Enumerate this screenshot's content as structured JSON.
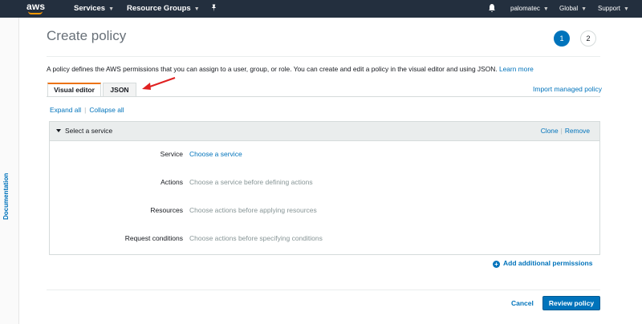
{
  "nav": {
    "logo": "aws",
    "services": "Services",
    "resource_groups": "Resource Groups",
    "user": "palomatec",
    "region": "Global",
    "support": "Support"
  },
  "sidebar": {
    "documentation": "Documentation"
  },
  "page": {
    "title": "Create policy",
    "steps": [
      "1",
      "2"
    ],
    "description": "A policy defines the AWS permissions that you can assign to a user, group, or role. You can create and edit a policy in the visual editor and using JSON.",
    "learn_more": "Learn more"
  },
  "tabs": [
    {
      "label": "Visual editor",
      "active": true
    },
    {
      "label": "JSON",
      "active": false
    }
  ],
  "import_managed_policy": "Import managed policy",
  "expand_all": "Expand all",
  "collapse_all": "Collapse all",
  "service_panel": {
    "title": "Select a service",
    "clone": "Clone",
    "remove": "Remove",
    "rows": [
      {
        "label": "Service",
        "value": "Choose a service"
      },
      {
        "label": "Actions",
        "value": "Choose a service before defining actions"
      },
      {
        "label": "Resources",
        "value": "Choose actions before applying resources"
      },
      {
        "label": "Request conditions",
        "value": "Choose actions before specifying conditions"
      }
    ]
  },
  "add_permissions": "Add additional permissions",
  "footer": {
    "cancel": "Cancel",
    "review": "Review policy"
  },
  "colors": {
    "nav_bg": "#232f3e",
    "accent": "#0073bb",
    "tab_accent": "#ec7211",
    "annotation_arrow": "#e02020"
  },
  "icons": [
    "bell-icon",
    "pin-icon",
    "caret-down-icon",
    "collapse-triangle-icon",
    "plus-circle-icon",
    "annotation-arrow"
  ]
}
